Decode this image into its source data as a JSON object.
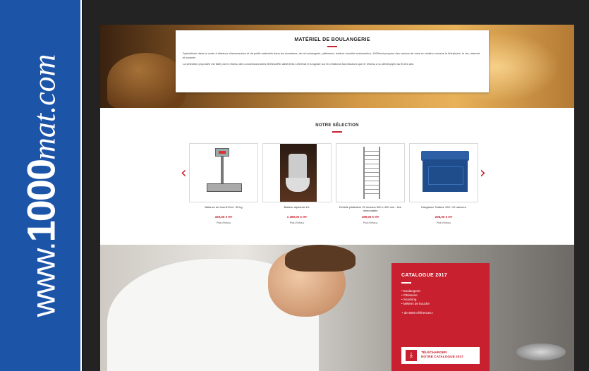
{
  "brand": {
    "prefix": "www.",
    "number": "1000",
    "domain": "mat.com",
    "color": "#1c55a8"
  },
  "hero": {
    "title": "MATÉRIEL DE BOULANGERIE",
    "paragraph1": "Spécialisée dans la vente à distance d'accessoires et de petits matériels dans les domaines, de la boulangerie, pâtisserie, traiteur et petite restauration, 1000mat propose des canaux de mise en relation comme le téléphone, le fax, internet et courrier.",
    "paragraph2": "La sélection proposée est faite par le réseau des concessionnaires BONGARD adhérents 1000mat et s'appuie sur les relations fournisseurs que le réseau a su développer au fil des ans."
  },
  "selection": {
    "title": "NOTRE SÉLECTION",
    "prev_icon": "chevron-left-icon",
    "next_icon": "chevron-right-icon",
    "products": [
      {
        "name": "Balance de fournil Eco+ 30 kg",
        "price": "329,00 € HT",
        "more": "Plus d'infos ▸"
      },
      {
        "name": "Batteur alphamix 8 L",
        "price": "1 369,00 € HT",
        "more": "Plus d'infos ▸"
      },
      {
        "name": "Echelle pâtissière 20 niveaux 600 x 400 mm - fixe démontable",
        "price": "199,00 € HT",
        "more": "Plus d'infos ▸"
      },
      {
        "name": "Kangabox Traiteur 128 / 10 rainures",
        "price": "208,00 € HT",
        "more": "Plus d'infos ▸"
      }
    ]
  },
  "catalog": {
    "title": "CATALOGUE 2017",
    "items": [
      "Boulangerie",
      "Pâtisserie",
      "Snacking",
      "Métiers de bouche"
    ],
    "references": "+ de 9000 références !",
    "download_line1": "TÉLÉCHARGER",
    "download_line2": "NOTRE CATALOGUE 2017",
    "download_icon": "download-icon",
    "color": "#c8202e"
  }
}
